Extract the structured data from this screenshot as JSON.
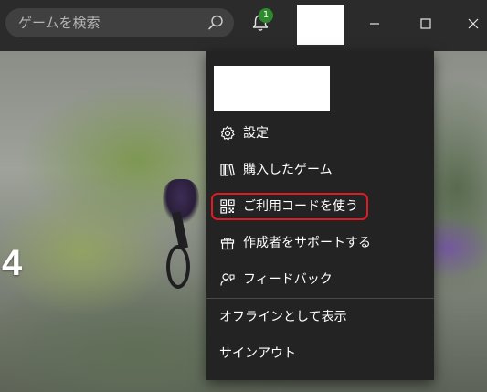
{
  "search": {
    "placeholder": "ゲームを検索",
    "icon": "search-icon"
  },
  "notifications": {
    "icon": "bell-icon",
    "badge_count": "1",
    "badge_color": "#2d8a2d"
  },
  "hero": {
    "number": "4"
  },
  "window_controls": {
    "minimize_icon": "minimize-icon",
    "maximize_icon": "maximize-icon",
    "close_icon": "close-icon"
  },
  "menu": {
    "items": [
      {
        "label": "設定",
        "icon": "gear-icon"
      },
      {
        "label": "購入したゲーム",
        "icon": "library-icon"
      },
      {
        "label": "ご利用コードを使う",
        "icon": "qr-code-icon",
        "highlighted": true,
        "highlight_color": "#e01b24"
      },
      {
        "label": "作成者をサポートする",
        "icon": "gift-icon"
      },
      {
        "label": "フィードバック",
        "icon": "feedback-icon"
      }
    ],
    "secondary_items": [
      {
        "label": "オフラインとして表示"
      },
      {
        "label": "サインアウト"
      }
    ]
  }
}
